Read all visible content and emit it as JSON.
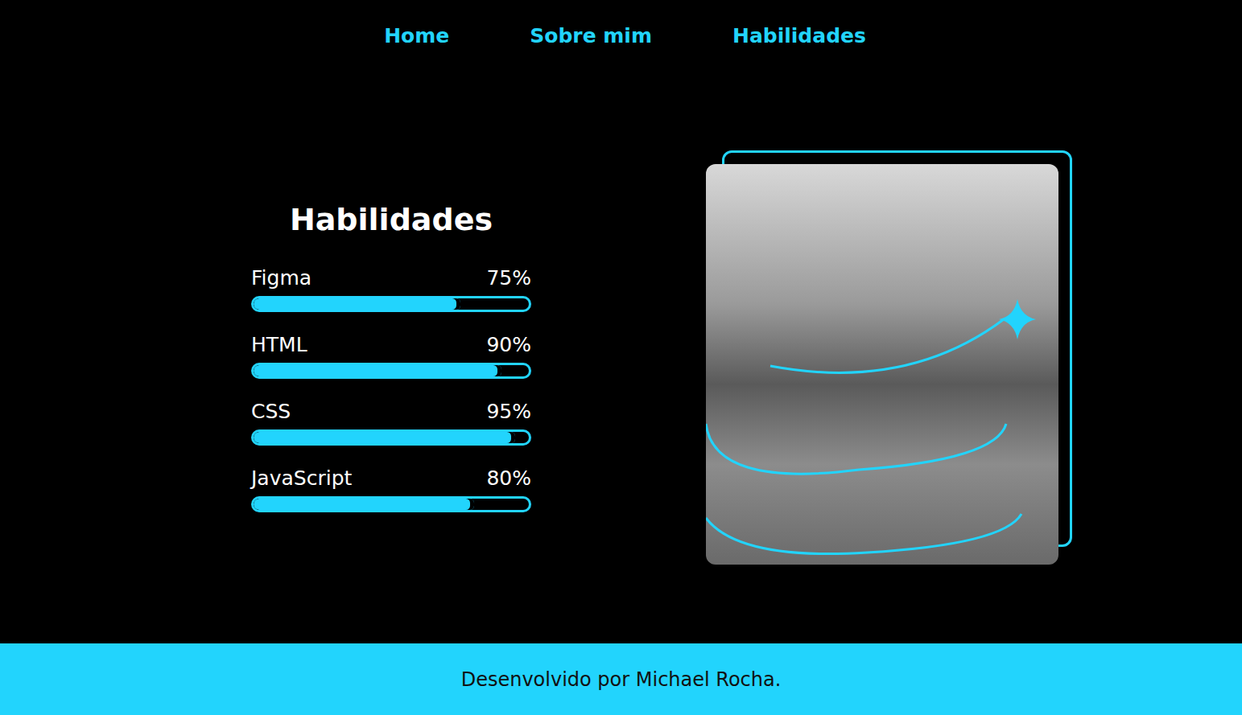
{
  "nav": [
    {
      "label": "Home"
    },
    {
      "label": "Sobre mim"
    },
    {
      "label": "Habilidades"
    }
  ],
  "skills": {
    "title": "Habilidades",
    "items": [
      {
        "name": "Figma",
        "reading": "75%",
        "level": 0.75
      },
      {
        "name": "HTML",
        "reading": "90%",
        "level": 0.9
      },
      {
        "name": "CSS",
        "reading": "95%",
        "level": 0.95
      },
      {
        "name": "JavaScript",
        "reading": "80%",
        "level": 0.8
      }
    ]
  },
  "footer": {
    "text": "Desenvolvido por Michael Rocha."
  }
}
